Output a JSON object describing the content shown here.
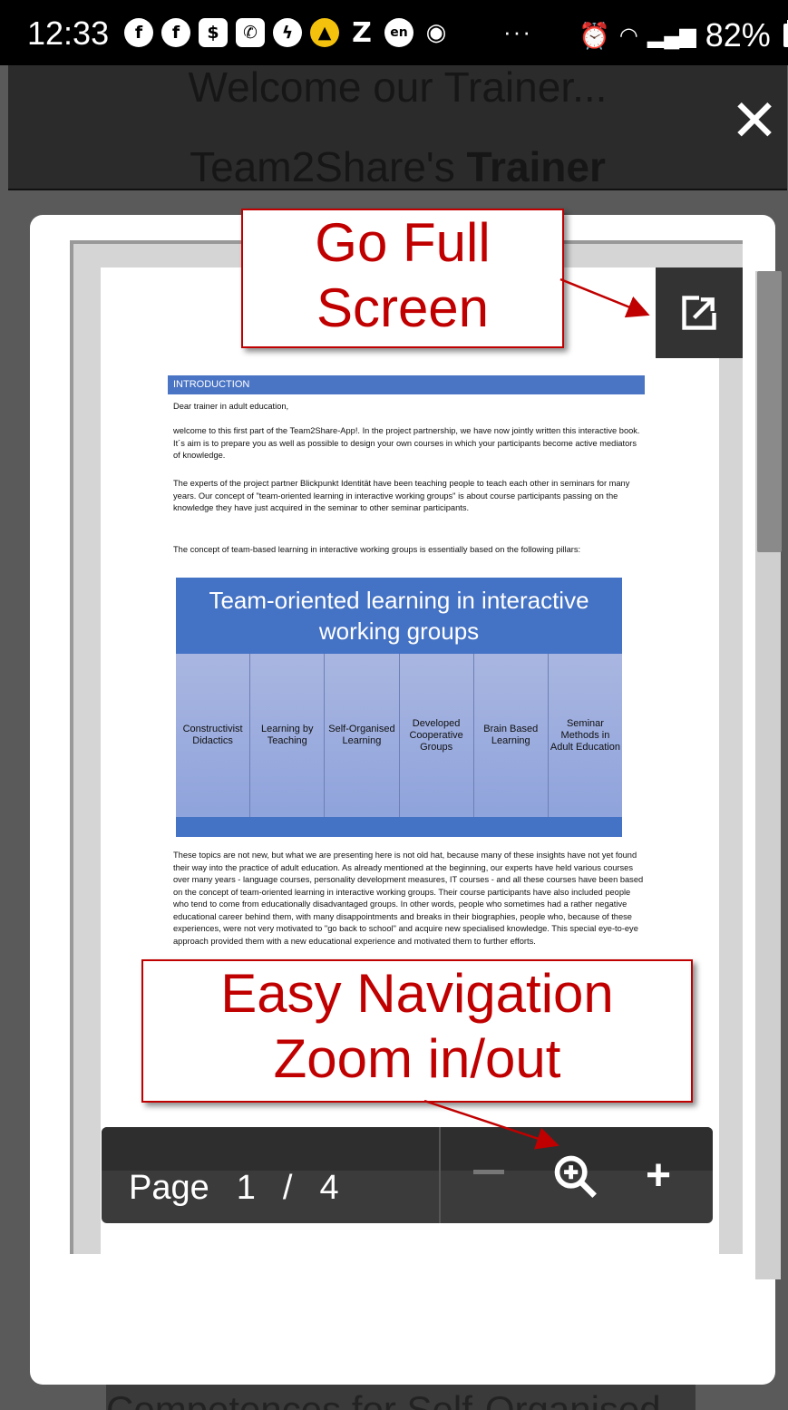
{
  "status_bar": {
    "time": "12:33",
    "battery": "82%",
    "notification_icons": [
      "facebook-icon",
      "facebook-icon",
      "dollar-app-icon",
      "messenger-icon",
      "messenger-icon",
      "taxi-icon",
      "z-app-icon",
      "en-app-icon",
      "shopping-bag-icon"
    ],
    "overflow": "···"
  },
  "background_header": {
    "line1": "Welcome our Trainer...",
    "line2_normal": "Team2Share's ",
    "line2_bold": "Trainer"
  },
  "background_footer": {
    "text": "Competences for Self-Organised"
  },
  "document": {
    "section_title": "INTRODUCTION",
    "greeting": "Dear trainer in adult education,",
    "para1": "welcome to this first part of the Team2Share-App!. In the project partnership, we have now jointly written this interactive book. It´s aim is to prepare you as well as possible to design your own courses in which your participants become active mediators of knowledge.",
    "para2": "The experts of the project partner Blickpunkt Identität have been teaching people to teach each other in seminars for many years. Our concept of \"team-oriented learning in interactive working groups\" is about course participants passing on the knowledge they have just acquired in the seminar to other seminar participants.",
    "para3": "The concept of team-based learning in interactive working groups is essentially based on the following pillars:",
    "diagram_title": "Team-oriented learning in interactive working groups",
    "pillars": [
      "Constructivist Didactics",
      "Learning by Teaching",
      "Self-Organised Learning",
      "Developed Cooperative Groups",
      "Brain Based Learning",
      "Seminar Methods in Adult Education"
    ],
    "para4": "These topics are not new, but what we are presenting here is not old hat, because many of these insights have not yet found their way into the practice of adult education. As already mentioned at the beginning, our experts have held various courses over many years - language courses, personality development measures, IT courses - and all these courses have been based on the concept of team-oriented learning in interactive working groups. Their course participants have also included people who tend to come from educationally disadvantaged groups. In other words, people who sometimes had a rather negative educational career behind them, with many disappointments and breaks in their biographies, people who, because of these experiences, were not very motivated to \"go back to school\" and acquire new specialised knowledge. This special eye-to-eye approach provided them with a new educational experience and motivated them to further efforts."
  },
  "callouts": {
    "fullscreen_line1": "Go Full",
    "fullscreen_line2": "Screen",
    "nav_line1": "Easy Navigation",
    "nav_line2": "Zoom in/out"
  },
  "navbar": {
    "page_label": "Page",
    "current_page": "1",
    "separator": "/",
    "total_pages": "4"
  },
  "colors": {
    "accent_blue": "#4472c4",
    "callout_red": "#c00000"
  }
}
